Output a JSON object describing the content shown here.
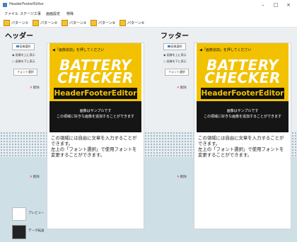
{
  "window": {
    "title": "HeaderFooterEditor",
    "minimize": "–",
    "maximize": "□",
    "close": "×"
  },
  "menu": [
    "ファイル",
    "ステージ工事",
    "画面設定",
    "特殊"
  ],
  "toolbar": [
    "パターン①",
    "パターン②",
    "パターン③",
    "パターン④",
    "パターン⑤"
  ],
  "header_panel": {
    "heading": "ヘッダー",
    "image_button": "画像選択",
    "radio1": "画像を上に表示",
    "radio2": "画像を下に表示",
    "font_button": "フォント選択",
    "delete1": "削除",
    "delete2": "削除"
  },
  "footer_panel": {
    "heading": "フッター",
    "image_button": "画像選択",
    "radio1": "画像を上に表示",
    "radio2": "画像を下に表示",
    "font_button": "フォント選択",
    "delete1": "削除",
    "delete2": "削除"
  },
  "sample": {
    "top_text": "◀「画像追加」を押してください",
    "title_line1": "BATTERY",
    "title_line2": "CHECKER",
    "app_name": "HeaderFooterEditor",
    "sample_line1": "画像はサンプルです",
    "sample_line2": "この領域に好きな画像を追加することができます",
    "body_text": "この領域には自由に文章を入力することができます。\n左上の「フォント選択」で使用フォントを変更することができます。"
  },
  "side_buttons": {
    "preview": "プレビュー",
    "data": "データ転送"
  }
}
